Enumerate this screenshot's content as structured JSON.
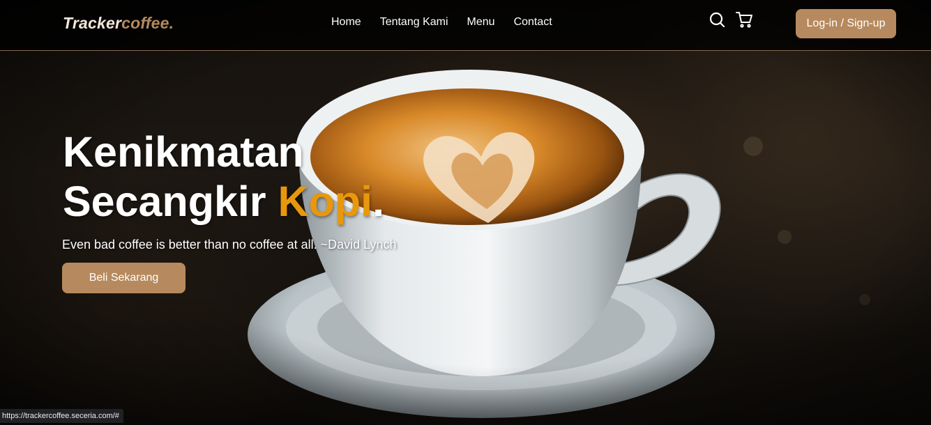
{
  "header": {
    "logo_main": "Tracker",
    "logo_accent": "coffee.",
    "nav": [
      {
        "label": "Home"
      },
      {
        "label": "Tentang Kami"
      },
      {
        "label": "Menu"
      },
      {
        "label": "Contact"
      }
    ],
    "icons": [
      "search-icon",
      "cart-icon"
    ],
    "login_label": "Log-in / Sign-up"
  },
  "hero": {
    "title_line1": "Kenikmatan",
    "title_line2_prefix": "Secangkir ",
    "title_highlight": "Kopi",
    "title_suffix": ".",
    "subtitle": "Even bad coffee is better than no coffee at all. ~David Lynch",
    "cta_label": "Beli Sekarang"
  },
  "status_bar": {
    "url": "https://trackercoffee.seceria.com/#"
  },
  "colors": {
    "accent": "#b68a5e",
    "highlight": "#e8980c",
    "navbar_bg": "#000000"
  }
}
